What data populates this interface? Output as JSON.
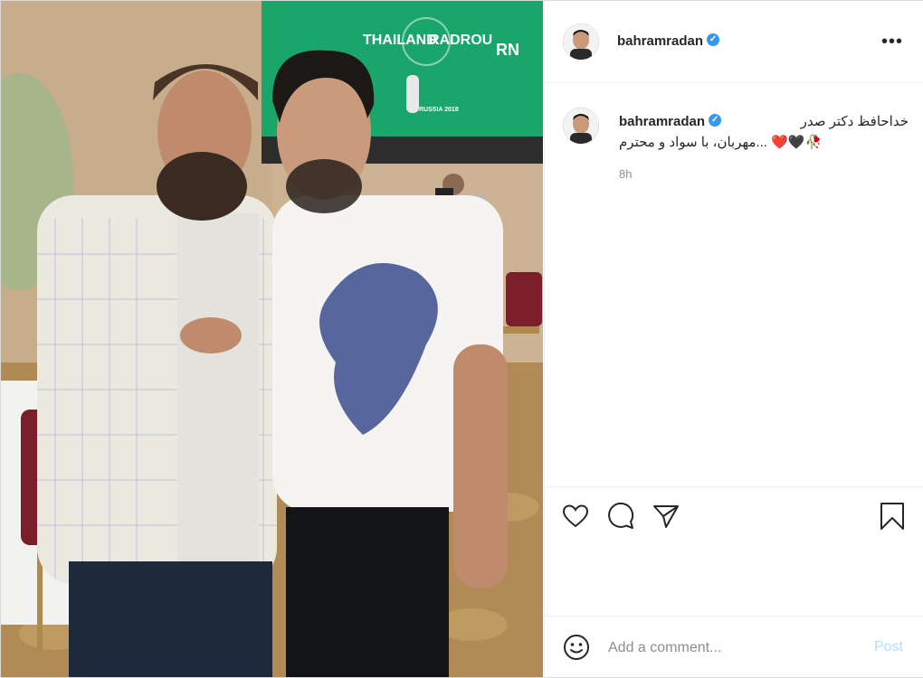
{
  "post": {
    "username": "bahramradan",
    "verified": true,
    "more_icon": "more-icon",
    "photo_screen_text": [
      "THAILAND",
      "RADROU",
      "RN",
      "RUSSIA 2018"
    ]
  },
  "caption": {
    "username": "bahramradan",
    "line1": "خداحافظ دکتر صدر",
    "line2": "...مهربان، با سواد و محترم",
    "emojis": "🥀🖤❤️"
  },
  "meta": {
    "time": "8h"
  },
  "actions": {
    "icons": [
      "heart-icon",
      "comment-icon",
      "share-icon",
      "bookmark-icon"
    ]
  },
  "comment_box": {
    "placeholder": "Add a comment...",
    "post_label": "Post"
  },
  "colors": {
    "link_disabled": "#b2dffc",
    "verified": "#3897f0",
    "text": "#262626",
    "muted": "#8e8e8e"
  }
}
